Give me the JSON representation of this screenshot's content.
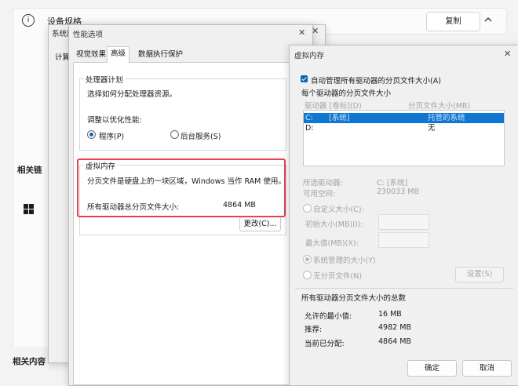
{
  "bg": {
    "device_specs_title": "设备规格",
    "copy_label": "复制",
    "related_links_label": "相关链",
    "related_content_label": "相关内容"
  },
  "sysprops": {
    "title": "系统属",
    "tab_partial": "计算"
  },
  "perf": {
    "title": "性能选项",
    "tabs": [
      "视觉效果",
      "高级",
      "数据执行保护"
    ],
    "processor_group_title": "处理器计划",
    "processor_desc": "选择如何分配处理器资源。",
    "adjust_label": "调整以优化性能:",
    "programs_label": "程序(P)",
    "background_label": "后台服务(S)",
    "vm_group_title": "虚拟内存",
    "vm_desc": "分页文件是硬盘上的一块区域，Windows 当作 RAM 使用。",
    "vm_total_label": "所有驱动器总分页文件大小:",
    "vm_total_value": "4864 MB",
    "change_button": "更改(C)..."
  },
  "vm": {
    "title": "虚拟内存",
    "auto_manage_label": "自动管理所有驱动器的分页文件大小(A)",
    "per_drive_title": "每个驱动器的分页文件大小",
    "col_drive": "驱动器 [卷标](D)",
    "col_size": "分页文件大小(MB)",
    "drives": [
      {
        "drive": "C:",
        "label": "[系统]",
        "size": "托管的系统"
      },
      {
        "drive": "D:",
        "label": "",
        "size": "无"
      }
    ],
    "selected_drive_label": "所选驱动器:",
    "selected_drive_value": "C: [系统]",
    "free_space_label": "可用空间:",
    "free_space_value": "230033 MB",
    "custom_size_label": "自定义大小(C):",
    "initial_size_label": "初始大小(MB)(I):",
    "max_size_label": "最大值(MB)(X):",
    "system_managed_label": "系统管理的大小(Y)",
    "no_paging_label": "无分页文件(N)",
    "set_button": "设置(S)",
    "totals_title": "所有驱动器分页文件大小的总数",
    "min_allowed_label": "允许的最小值:",
    "min_allowed_value": "16 MB",
    "recommended_label": "推荐:",
    "recommended_value": "4982 MB",
    "current_label": "当前已分配:",
    "current_value": "4864 MB",
    "ok_button": "确定",
    "cancel_button": "取消"
  }
}
